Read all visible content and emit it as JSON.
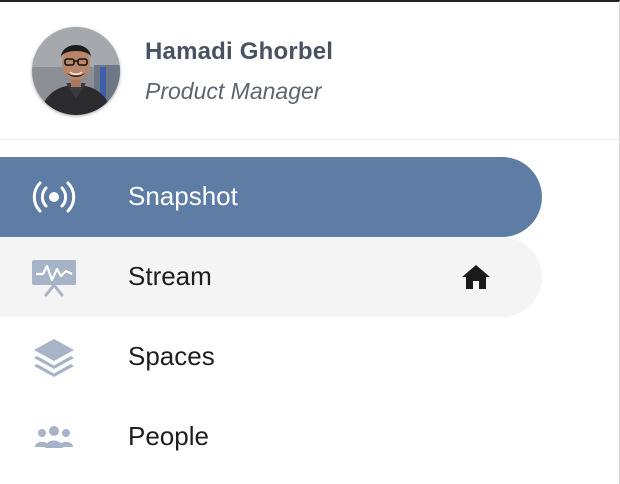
{
  "profile": {
    "name": "Hamadi Ghorbel",
    "role": "Product Manager",
    "avatar_icon": "user-photo"
  },
  "nav": {
    "items": [
      {
        "label": "Snapshot",
        "icon": "broadcast-icon",
        "state": "active"
      },
      {
        "label": "Stream",
        "icon": "monitor-pulse-icon",
        "state": "hover",
        "trailing_icon": "home-icon"
      },
      {
        "label": "Spaces",
        "icon": "layers-icon",
        "state": "default"
      },
      {
        "label": "People",
        "icon": "people-icon",
        "state": "default"
      }
    ]
  },
  "colors": {
    "active_bg": "#5f7ca5",
    "hover_bg": "#f4f4f4",
    "icon_muted": "#a7b3c7",
    "name_text": "#4a5160"
  }
}
